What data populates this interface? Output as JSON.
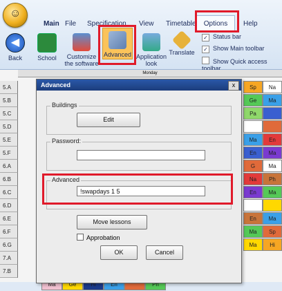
{
  "ribbon": {
    "tabs": [
      "Main",
      "File",
      "Specification",
      "View",
      "Timetable",
      "Options",
      "Help"
    ],
    "buttons": [
      {
        "label": "Back",
        "icon": "back-arrow-icon"
      },
      {
        "label": "School",
        "icon": "school-icon"
      },
      {
        "label": "Customize the software",
        "icon": "customize-icon"
      },
      {
        "label": "Advanced",
        "icon": "tools-icon"
      },
      {
        "label": "Application look",
        "icon": "palette-icon"
      },
      {
        "label": "Translate",
        "icon": "translate-icon"
      }
    ],
    "checks": [
      {
        "label": "Status bar",
        "checked": true
      },
      {
        "label": "Show Main toolbar",
        "checked": true
      },
      {
        "label": "Show Quick access toolbar",
        "checked": false
      }
    ]
  },
  "grid": {
    "day_header": "Monday",
    "rows": [
      "5.A",
      "5.B",
      "5.C",
      "5.D",
      "5.E",
      "5.F",
      "6.A",
      "6.B",
      "6.C",
      "6.D",
      "6.E",
      "6.F",
      "6.G",
      "7.A",
      "7.B"
    ],
    "right_cells": [
      [
        "Sp",
        "Na"
      ],
      [
        "Ge",
        "Ma"
      ],
      [
        "Pa",
        ""
      ],
      [
        "",
        ""
      ],
      [
        "Ma",
        "En"
      ],
      [
        "En",
        "Ma"
      ],
      [
        "G",
        "Ma"
      ],
      [
        "Na",
        "Ph"
      ],
      [
        "En",
        "Ma"
      ],
      [
        "",
        ""
      ],
      [
        "En",
        "Ma"
      ],
      [
        "Ma",
        "Sp"
      ],
      [
        "Ma",
        "Hi"
      ],
      [
        "Ma",
        "Ph"
      ],
      [
        "Ch",
        ""
      ]
    ],
    "bottom_cells": [
      [
        "Ma",
        "En",
        "",
        "Hi",
        "Ch",
        "Na"
      ],
      [
        "Ma",
        "Ge",
        "Hi",
        "En",
        "",
        "Ph"
      ]
    ]
  },
  "dialog": {
    "title": "Advanced",
    "close": "x",
    "buildings_label": "Buildings",
    "edit_button": "Edit",
    "password_label": "Password:",
    "password_value": "",
    "advanced_label": "Advanced",
    "advanced_value": "!swapdays 1 5",
    "move_lessons_button": "Move lessons",
    "approbation_label": "Approbation",
    "ok_button": "OK",
    "cancel_button": "Cancel"
  }
}
